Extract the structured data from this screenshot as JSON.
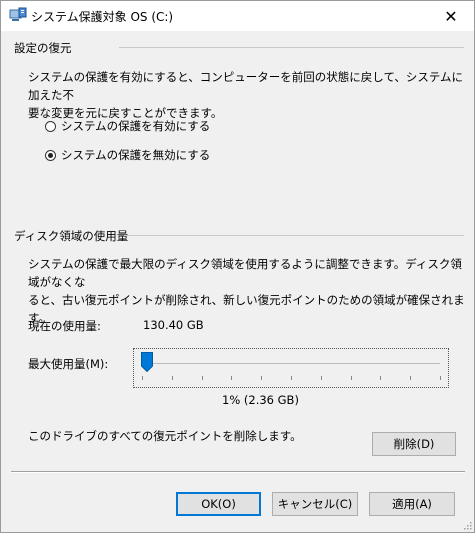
{
  "window": {
    "title": "システム保護対象 OS (C:)",
    "close_glyph": "✕"
  },
  "restore_settings": {
    "group_title": "設定の復元",
    "description": "システムの保護を有効にすると、コンピューターを前回の状態に戻して、システムに加えた不\n要な変更を元に戻すことができます。",
    "options": [
      {
        "label": "システムの保護を有効にする",
        "checked": false
      },
      {
        "label": "システムの保護を無効にする",
        "checked": true
      }
    ]
  },
  "disk_usage": {
    "group_title": "ディスク領域の使用量",
    "description": "システムの保護で最大限のディスク領域を使用するように調整できます。ディスク領域がなくな\nると、古い復元ポイントが削除され、新しい復元ポイントのための領域が確保されます。",
    "current_label": "現在の使用量:",
    "current_value": "130.40 GB",
    "max_label": "最大使用量(M):",
    "slider_percent": 1,
    "slider_value_text": "1% (2.36 GB)"
  },
  "delete_section": {
    "text": "このドライブのすべての復元ポイントを削除します。",
    "button": "削除(D)"
  },
  "buttons": {
    "ok": "OK(O)",
    "cancel": "キャンセル(C)",
    "apply": "適用(A)"
  },
  "colors": {
    "accent": "#0078d7",
    "thumb": "#0078d7"
  }
}
